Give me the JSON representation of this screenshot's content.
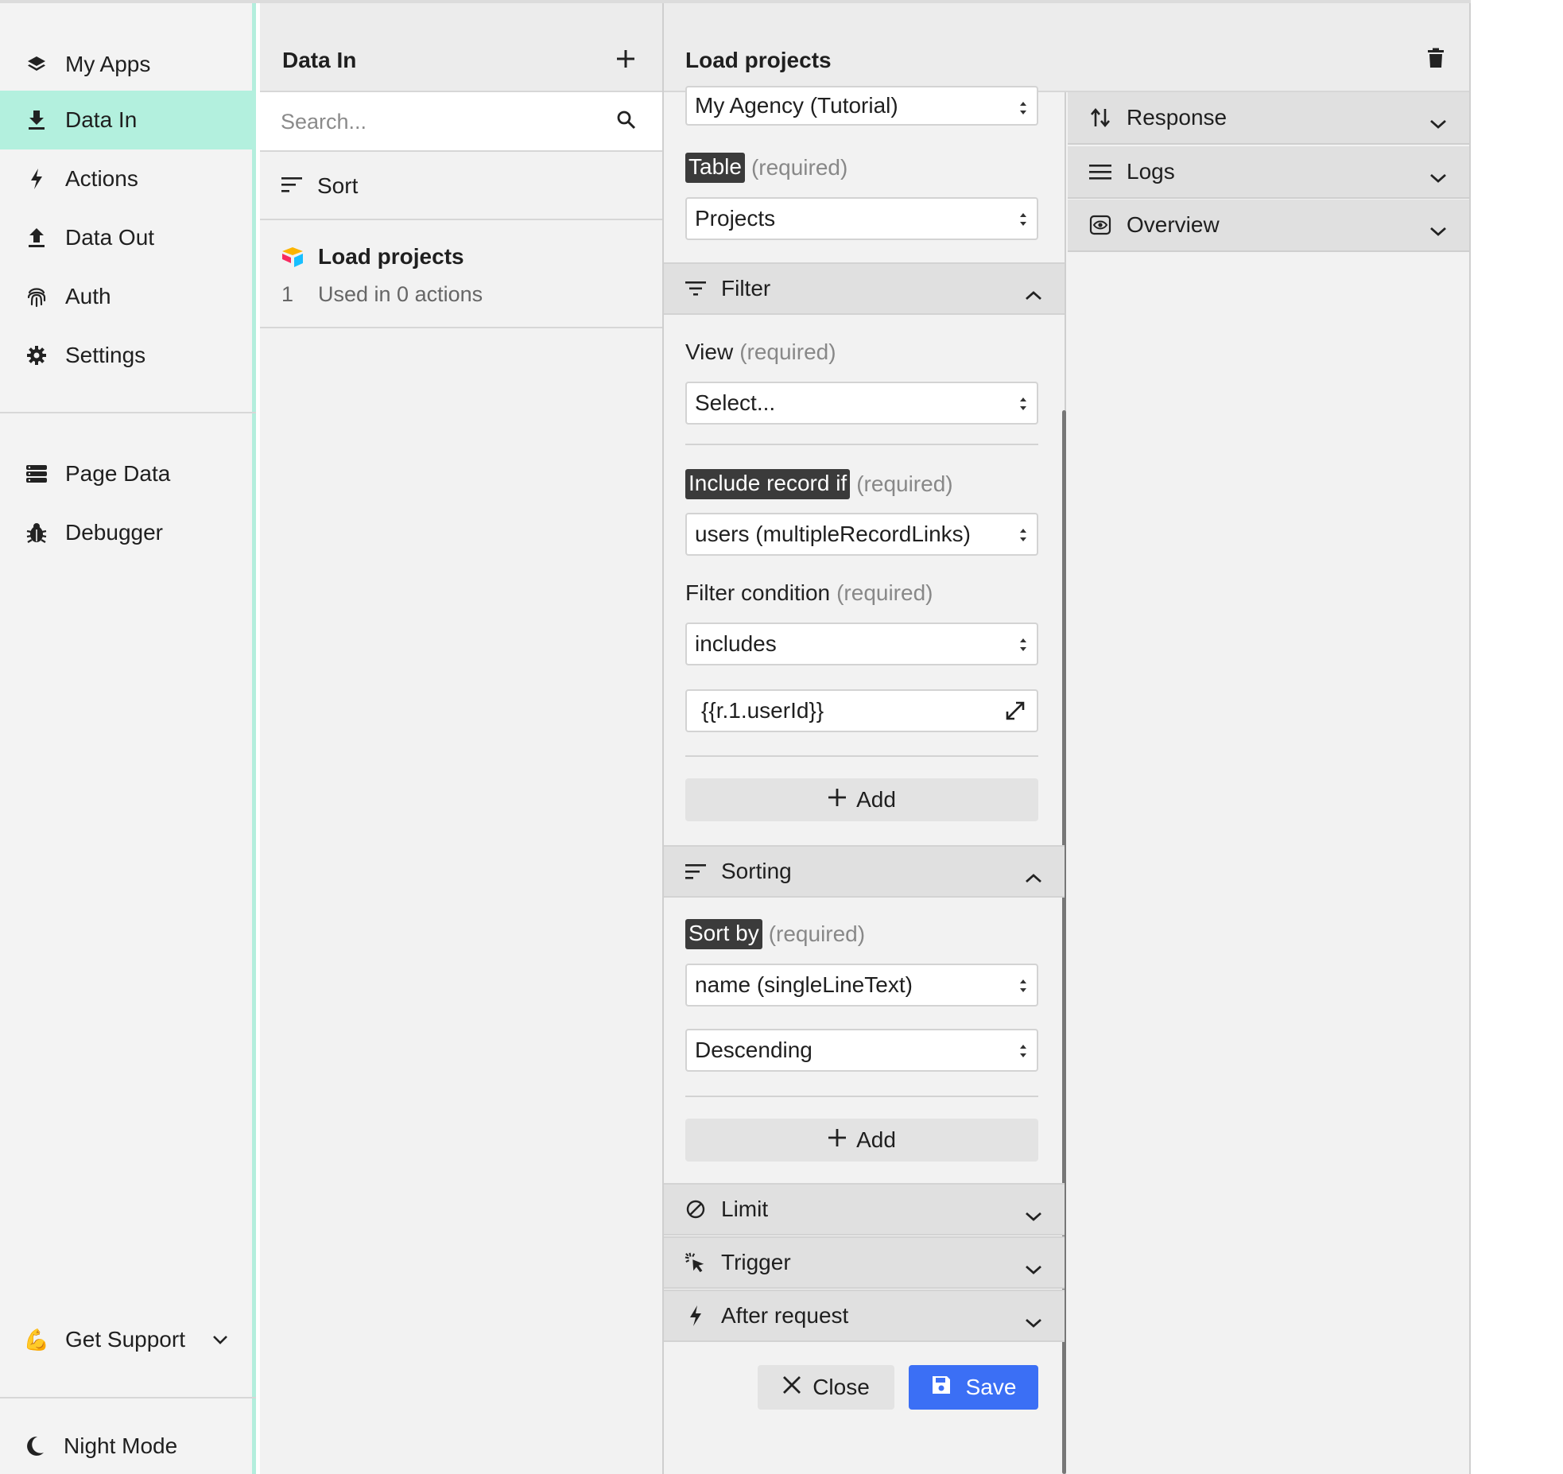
{
  "nav": {
    "items": [
      {
        "label": "My Apps",
        "icon": "layers-icon"
      },
      {
        "label": "Data In",
        "icon": "download-icon",
        "active": true
      },
      {
        "label": "Actions",
        "icon": "bolt-icon"
      },
      {
        "label": "Data Out",
        "icon": "upload-icon"
      },
      {
        "label": "Auth",
        "icon": "fingerprint-icon"
      },
      {
        "label": "Settings",
        "icon": "gear-icon"
      },
      {
        "label": "Page Data",
        "icon": "database-icon"
      },
      {
        "label": "Debugger",
        "icon": "bug-icon"
      }
    ],
    "support_label": "Get Support",
    "support_emoji": "💪",
    "night_mode_label": "Night Mode"
  },
  "list": {
    "title": "Data In",
    "search_placeholder": "Search...",
    "sort_label": "Sort",
    "items": [
      {
        "name": "Load projects",
        "number": "1",
        "subtitle": "Used in 0 actions"
      }
    ]
  },
  "editor": {
    "title": "Load projects",
    "base_value": "My Agency (Tutorial)",
    "table": {
      "label": "Table",
      "req": "(required)",
      "value": "Projects"
    },
    "filter": {
      "heading": "Filter",
      "view": {
        "label": "View",
        "req": "(required)",
        "value": "Select..."
      },
      "include": {
        "label": "Include record if",
        "req": "(required)",
        "value": "users (multipleRecordLinks)"
      },
      "condition": {
        "label": "Filter condition",
        "req": "(required)",
        "value": "includes"
      },
      "expression": "{{r.1.userId}}",
      "add_label": "Add"
    },
    "sorting": {
      "heading": "Sorting",
      "sort_by": {
        "label": "Sort by",
        "req": "(required)",
        "value": "name (singleLineText)"
      },
      "direction": "Descending",
      "add_label": "Add"
    },
    "limit_label": "Limit",
    "trigger_label": "Trigger",
    "after_request_label": "After request",
    "close_label": "Close",
    "save_label": "Save",
    "right_panels": [
      {
        "label": "Response",
        "icon": "arrows-updown-icon"
      },
      {
        "label": "Logs",
        "icon": "lines-icon"
      },
      {
        "label": "Overview",
        "icon": "eye-icon"
      }
    ]
  },
  "colors": {
    "accent": "#b3f0de",
    "primary": "#3b6ff5",
    "tag": "#3b3b3b"
  }
}
